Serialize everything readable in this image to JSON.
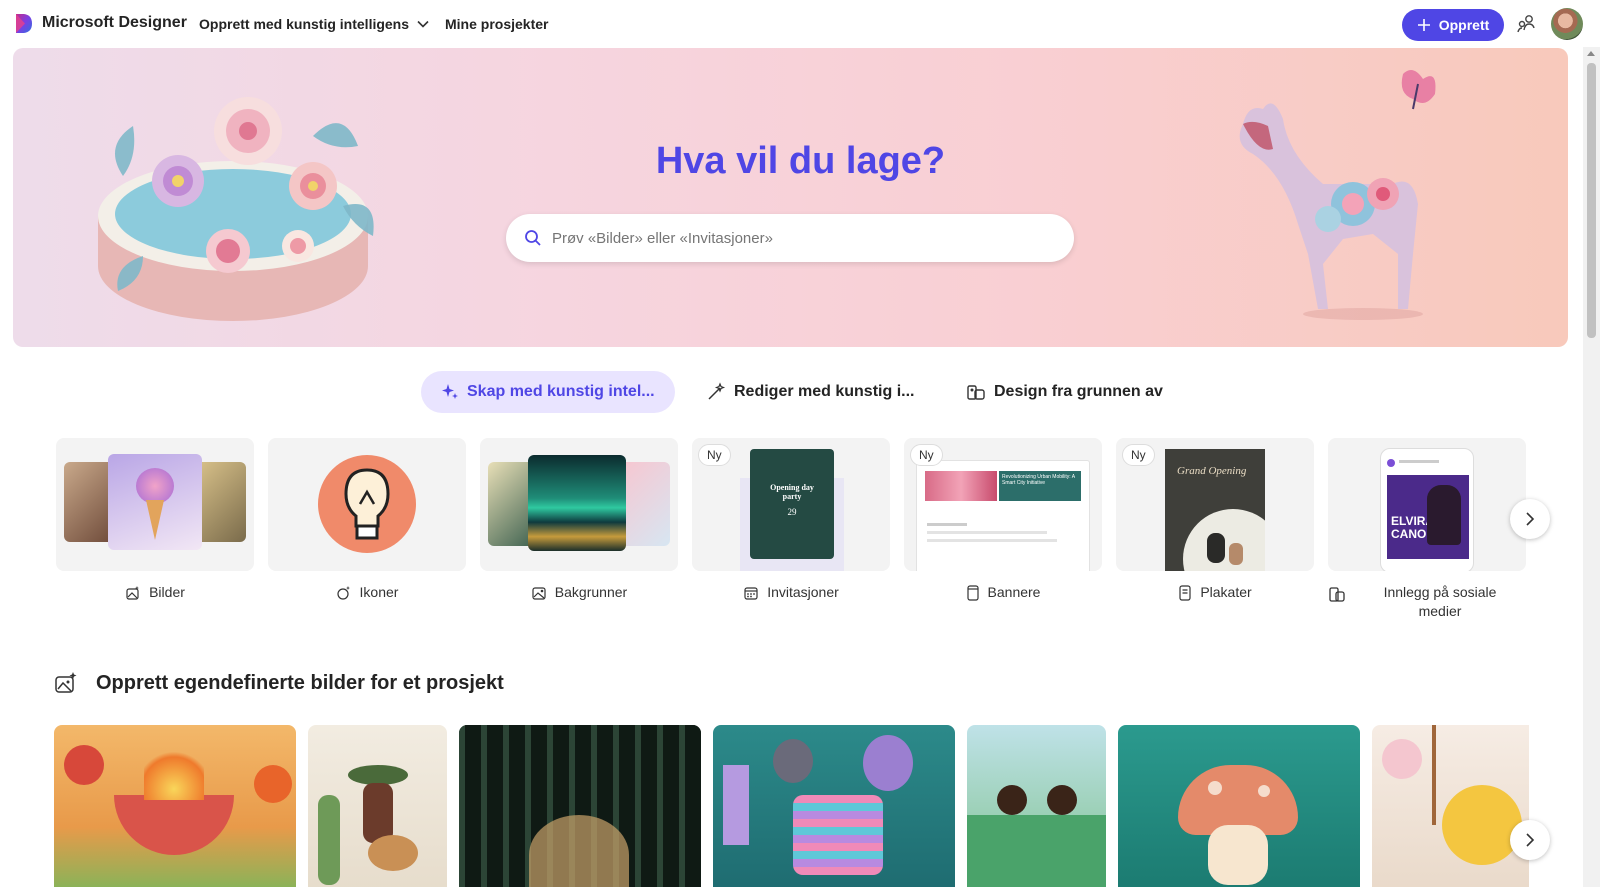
{
  "header": {
    "brand": "Microsoft Designer",
    "nav_ai": "Opprett med kunstig intelligens",
    "nav_projects": "Mine prosjekter",
    "create_label": "Opprett",
    "accent": "#4f46e5"
  },
  "hero": {
    "title": "Hva vil du lage?",
    "search_placeholder": "Prøv «Bilder» eller «Invitasjoner»"
  },
  "tabs": [
    {
      "label": "Skap med kunstig intel...",
      "icon": "sparkle-icon",
      "active": true
    },
    {
      "label": "Rediger med kunstig i...",
      "icon": "magic-wand-icon",
      "active": false
    },
    {
      "label": "Design fra grunnen av",
      "icon": "design-icon",
      "active": false
    }
  ],
  "categories": [
    {
      "label": "Bilder",
      "icon": "image-sparkle-icon",
      "badge": ""
    },
    {
      "label": "Ikoner",
      "icon": "icon-sparkle-icon",
      "badge": ""
    },
    {
      "label": "Bakgrunner",
      "icon": "background-icon",
      "badge": ""
    },
    {
      "label": "Invitasjoner",
      "icon": "calendar-icon",
      "badge": "Ny"
    },
    {
      "label": "Bannere",
      "icon": "banner-icon",
      "badge": "Ny"
    },
    {
      "label": "Plakater",
      "icon": "poster-icon",
      "badge": "Ny"
    },
    {
      "label": "Innlegg på sosiale medier",
      "icon": "social-post-icon",
      "badge": ""
    }
  ],
  "card_texts": {
    "invite_title": "Opening day party",
    "invite_date": "29",
    "banner_text": "Revolutionizing Urban Mobility: A Smart City Initiative",
    "poster_text": "Grand Opening",
    "social_name": "ELVIRA CANO"
  },
  "section": {
    "title": "Opprett egendefinerte bilder for et prosjekt"
  }
}
